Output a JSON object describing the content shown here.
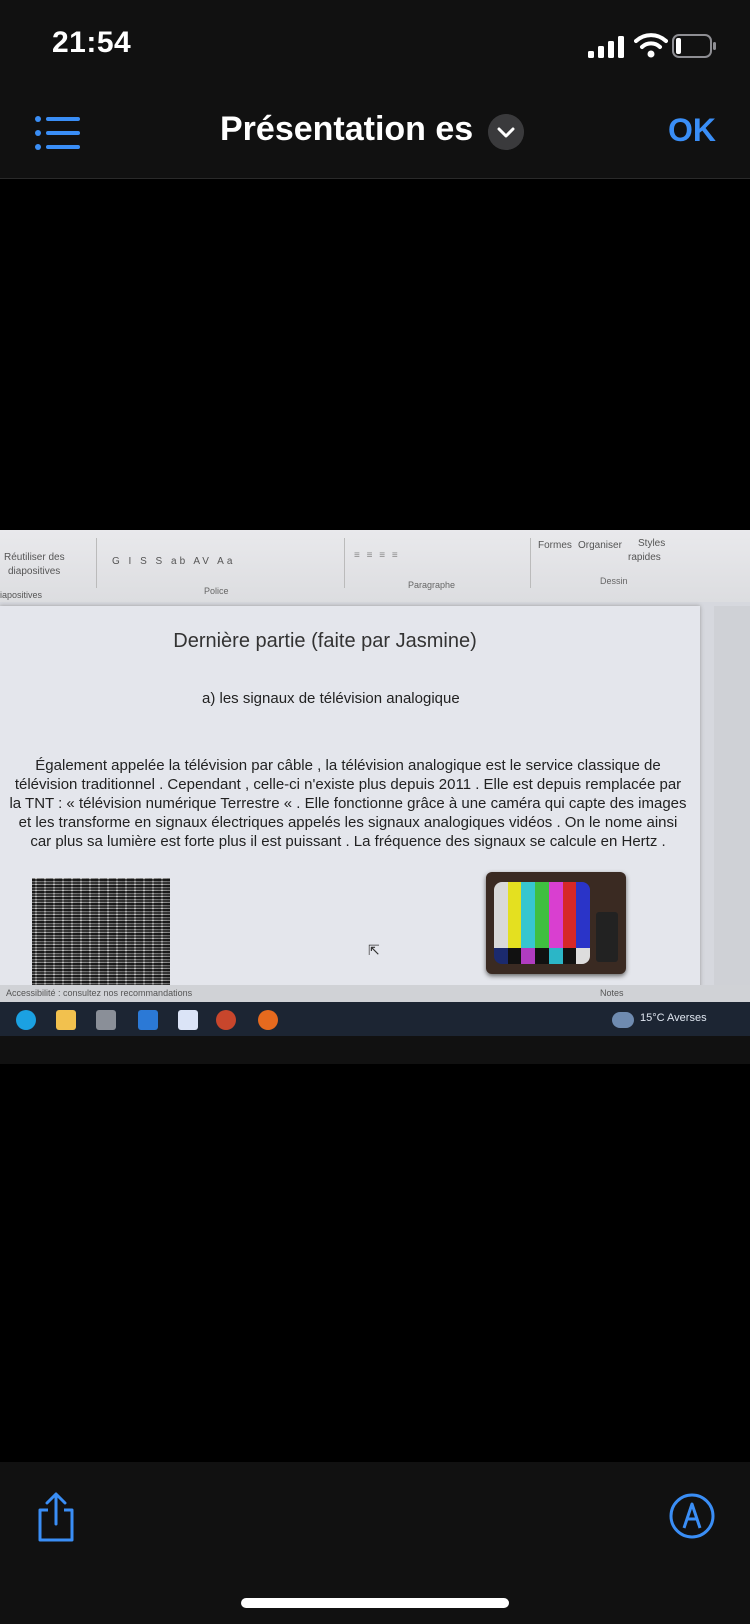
{
  "status": {
    "time": "21:54"
  },
  "nav": {
    "title": "Présentation es",
    "done": "OK"
  },
  "ribbon": {
    "reuse_label_1": "Réutiliser des",
    "reuse_label_2": "diapositives",
    "font_tools": "G I S S ab AV Aa",
    "police": "Police",
    "paragraphe": "Paragraphe",
    "formes": "Formes",
    "organiser": "Organiser",
    "styles": "Styles",
    "rapides": "rapides",
    "dessin": "Dessin",
    "pane_label": "iapositives"
  },
  "slide": {
    "title": "Dernière partie (faite par Jasmine)",
    "subtitle": "a)   les signaux de télévision analogique",
    "body": "Également appelée la télévision par câble , la télévision analogique est le service classique de télévision traditionnel . Cependant , celle-ci n'existe plus depuis 2011 . Elle est depuis remplacée par la TNT : « télévision numérique Terrestre « . Elle fonctionne grâce à une caméra qui capte des images et les transforme en signaux électriques appelés les signaux analogiques vidéos . On le nome ainsi car plus sa lumière est forte plus il est puissant . La fréquence des signaux se calcule en Hertz ."
  },
  "statusline": {
    "accessibility": "Accessibilité : consultez nos recommandations",
    "notes": "Notes"
  },
  "taskbar": {
    "weather": "15°C  Averses"
  },
  "colors": {
    "accent": "#3a8ef6",
    "background": "#000000",
    "bar": "#111111"
  }
}
